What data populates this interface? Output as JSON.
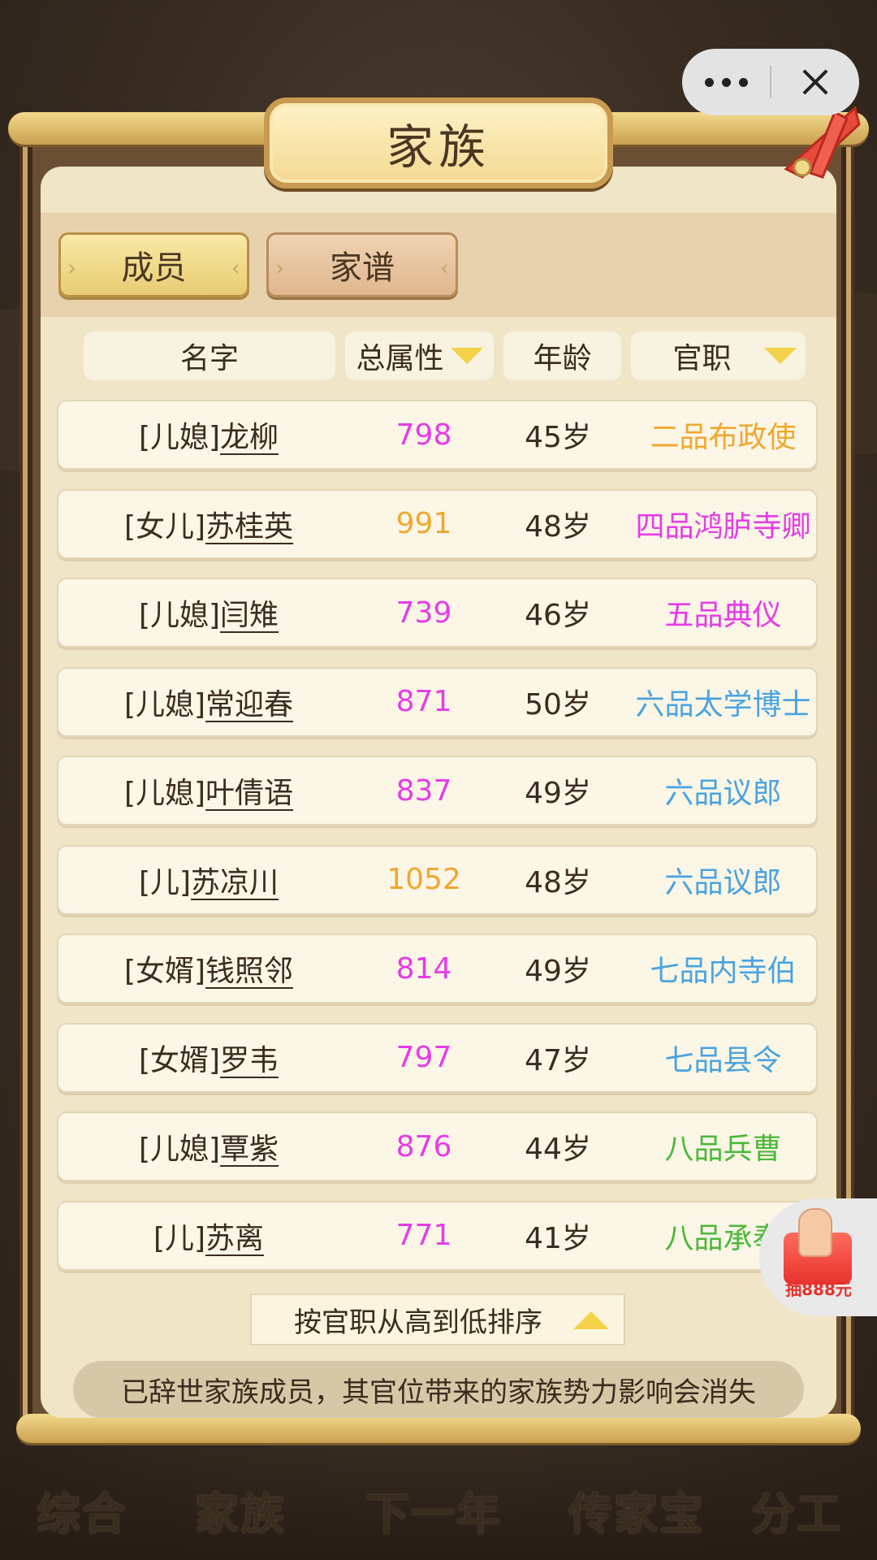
{
  "capsule": {
    "more_icon": "more-dots-icon",
    "close_icon": "close-icon"
  },
  "dialog": {
    "title": "家族"
  },
  "tabs": [
    {
      "label": "成员",
      "active": true
    },
    {
      "label": "家谱",
      "active": false
    }
  ],
  "table": {
    "headers": {
      "name": "名字",
      "attr": "总属性",
      "age": "年龄",
      "office": "官职"
    },
    "rows": [
      {
        "prefix": "[儿媳]",
        "name": "龙柳",
        "attr": "798",
        "attr_color": "#e63ce6",
        "age": "45岁",
        "office": "二品布政使",
        "office_color": "#f0a830"
      },
      {
        "prefix": "[女儿]",
        "name": "苏桂英",
        "attr": "991",
        "attr_color": "#f0a830",
        "age": "48岁",
        "office": "四品鸿胪寺卿",
        "office_color": "#e63ce6"
      },
      {
        "prefix": "[儿媳]",
        "name": "闫雉",
        "attr": "739",
        "attr_color": "#e63ce6",
        "age": "46岁",
        "office": "五品典仪",
        "office_color": "#e63ce6"
      },
      {
        "prefix": "[儿媳]",
        "name": "常迎春",
        "attr": "871",
        "attr_color": "#e63ce6",
        "age": "50岁",
        "office": "六品太学博士",
        "office_color": "#4aa3e0"
      },
      {
        "prefix": "[儿媳]",
        "name": "叶倩语",
        "attr": "837",
        "attr_color": "#e63ce6",
        "age": "49岁",
        "office": "六品议郎",
        "office_color": "#4aa3e0"
      },
      {
        "prefix": "[儿]",
        "name": "苏凉川",
        "attr": "1052",
        "attr_color": "#f0a830",
        "age": "48岁",
        "office": "六品议郎",
        "office_color": "#4aa3e0"
      },
      {
        "prefix": "[女婿]",
        "name": "钱照邻",
        "attr": "814",
        "attr_color": "#e63ce6",
        "age": "49岁",
        "office": "七品内寺伯",
        "office_color": "#4aa3e0"
      },
      {
        "prefix": "[女婿]",
        "name": "罗韦",
        "attr": "797",
        "attr_color": "#e63ce6",
        "age": "47岁",
        "office": "七品县令",
        "office_color": "#4aa3e0"
      },
      {
        "prefix": "[儿媳]",
        "name": "覃紫",
        "attr": "876",
        "attr_color": "#e63ce6",
        "age": "44岁",
        "office": "八品兵曹",
        "office_color": "#4cb83a"
      },
      {
        "prefix": "[儿]",
        "name": "苏离",
        "attr": "771",
        "attr_color": "#e63ce6",
        "age": "41岁",
        "office": "八品承奉",
        "office_color": "#4cb83a"
      }
    ]
  },
  "sort": {
    "label": "按官职从高到低排序"
  },
  "notice": "已辞世家族成员，其官位带来的家族势力影响会消失",
  "promo": {
    "label": "抽888元"
  },
  "bottom_nav": [
    "综合",
    "家族",
    "下一年",
    "传家宝",
    "分工"
  ]
}
